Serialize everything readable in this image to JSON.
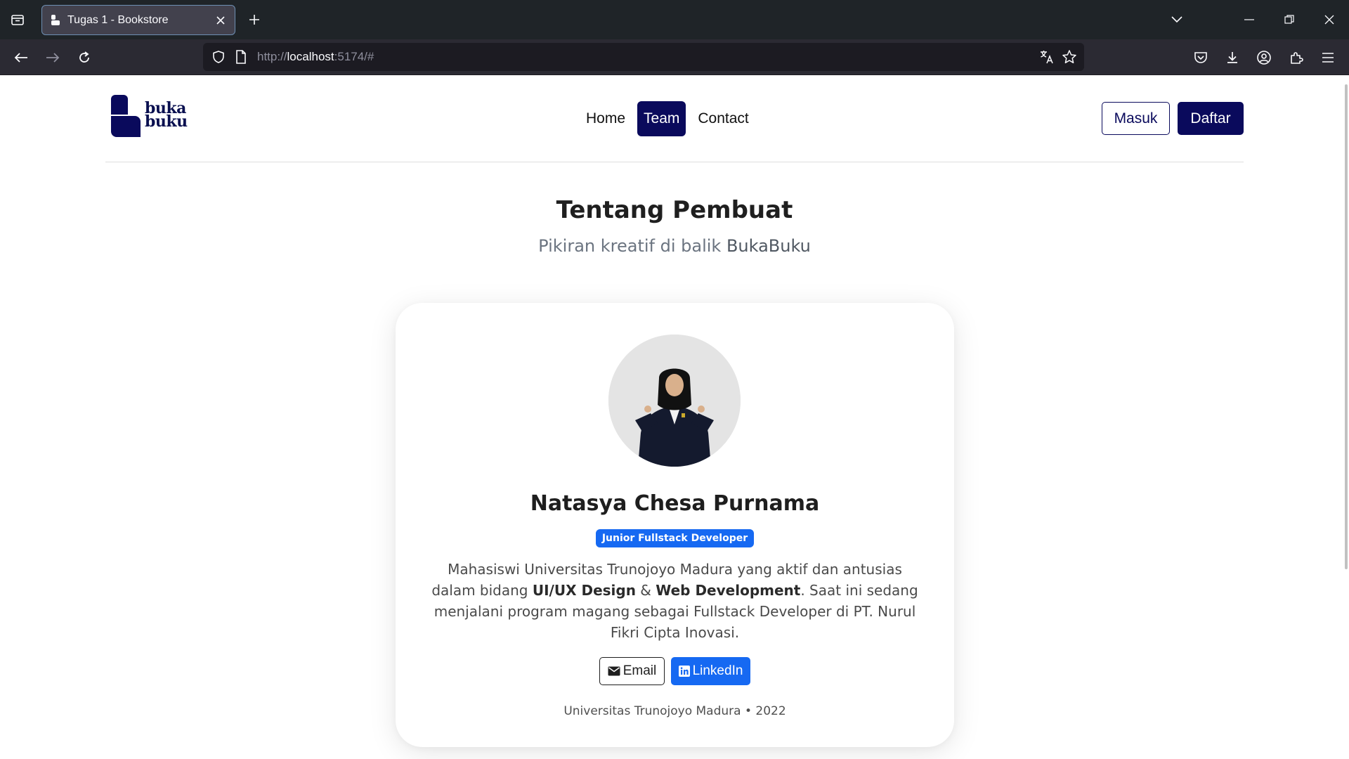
{
  "browser": {
    "tab_title": "Tugas 1 - Bookstore",
    "url_scheme": "http://",
    "url_host": "localhost",
    "url_rest": ":5174/#"
  },
  "site": {
    "logo_line1": "buka",
    "logo_line2": "buku",
    "nav": {
      "home": "Home",
      "team": "Team",
      "contact": "Contact"
    },
    "login_label": "Masuk",
    "register_label": "Daftar",
    "active_color": "#0a0a5c"
  },
  "hero": {
    "title": "Tentang Pembuat",
    "subtitle_prefix": "Pikiran kreatif di balik ",
    "subtitle_brand": "BukaBuku"
  },
  "member": {
    "name": "Natasya Chesa Purnama",
    "role": "Junior Fullstack Developer",
    "bio_1": "Mahasiswi Universitas Trunojoyo Madura yang aktif dan antusias dalam bidang ",
    "bio_bold_1": "UI/UX Design",
    "bio_2": " & ",
    "bio_bold_2": "Web Development",
    "bio_3": ". Saat ini sedang menjalani program magang sebagai Fullstack Developer di PT. Nurul Fikri Cipta Inovasi.",
    "email_label": "Email",
    "linkedin_label": "LinkedIn",
    "footer": "Universitas Trunojoyo Madura • 2022",
    "badge_color": "#1669f2"
  }
}
